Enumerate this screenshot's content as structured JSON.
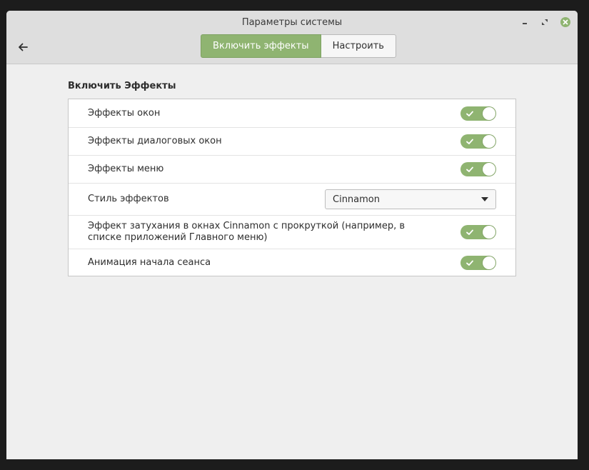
{
  "window": {
    "title": "Параметры системы"
  },
  "header": {
    "back_icon": "arrow-left-icon",
    "tabs": [
      {
        "label": "Включить эффекты",
        "active": true
      },
      {
        "label": "Настроить",
        "active": false
      }
    ]
  },
  "section": {
    "title": "Включить Эффекты",
    "rows": [
      {
        "label": "Эффекты окон",
        "control": "switch",
        "on": true
      },
      {
        "label": "Эффекты диалоговых окон",
        "control": "switch",
        "on": true
      },
      {
        "label": "Эффекты меню",
        "control": "switch",
        "on": true
      },
      {
        "label": "Стиль эффектов",
        "control": "dropdown",
        "value": "Cinnamon"
      },
      {
        "label": "Эффект затухания в окнах Cinnamon с прокруткой (например, в списке приложений Главного меню)",
        "control": "switch",
        "on": true
      },
      {
        "label": "Анимация начала сеанса",
        "control": "switch",
        "on": true
      }
    ]
  },
  "colors": {
    "accent": "#8fb471",
    "close_button": "#8fb471"
  }
}
